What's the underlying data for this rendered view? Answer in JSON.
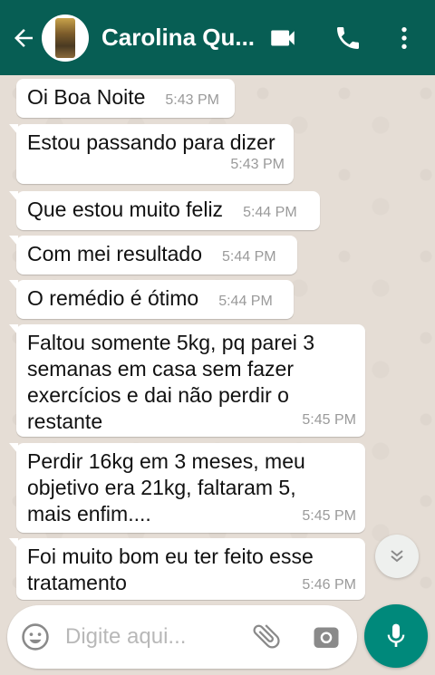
{
  "colors": {
    "header": "#075e54",
    "accent": "#00897b",
    "chat_bg": "#e5ddd5"
  },
  "header": {
    "contact_name": "Carolina Qu...",
    "back_icon": "arrow-left-icon",
    "video_icon": "video-call-icon",
    "call_icon": "phone-icon",
    "menu_icon": "more-vert-icon"
  },
  "messages": [
    {
      "text": "Oi Boa Noite",
      "time": "5:43 PM"
    },
    {
      "text": "Estou passando para dizer",
      "time": "5:43 PM"
    },
    {
      "text": "Que estou muito feliz",
      "time": "5:44 PM"
    },
    {
      "text": "Com mei resultado",
      "time": "5:44 PM"
    },
    {
      "text": "O remédio é ótimo",
      "time": "5:44 PM"
    },
    {
      "text": "Faltou somente 5kg, pq parei 3 semanas em casa sem fazer exercícios e dai não perdir o restante",
      "time": "5:45 PM"
    },
    {
      "text": "Perdir 16kg em 3 meses, meu objetivo era 21kg, faltaram 5, mais enfim....",
      "time": "5:45 PM"
    },
    {
      "text": "Foi muito bom eu ter feito esse tratamento",
      "time": "5:46 PM"
    }
  ],
  "composer": {
    "placeholder": "Digite aqui...",
    "value": "",
    "emoji_icon": "emoji-icon",
    "attach_icon": "paperclip-icon",
    "camera_icon": "camera-icon",
    "mic_icon": "microphone-icon"
  },
  "scroll_down_icon": "double-chevron-down-icon"
}
